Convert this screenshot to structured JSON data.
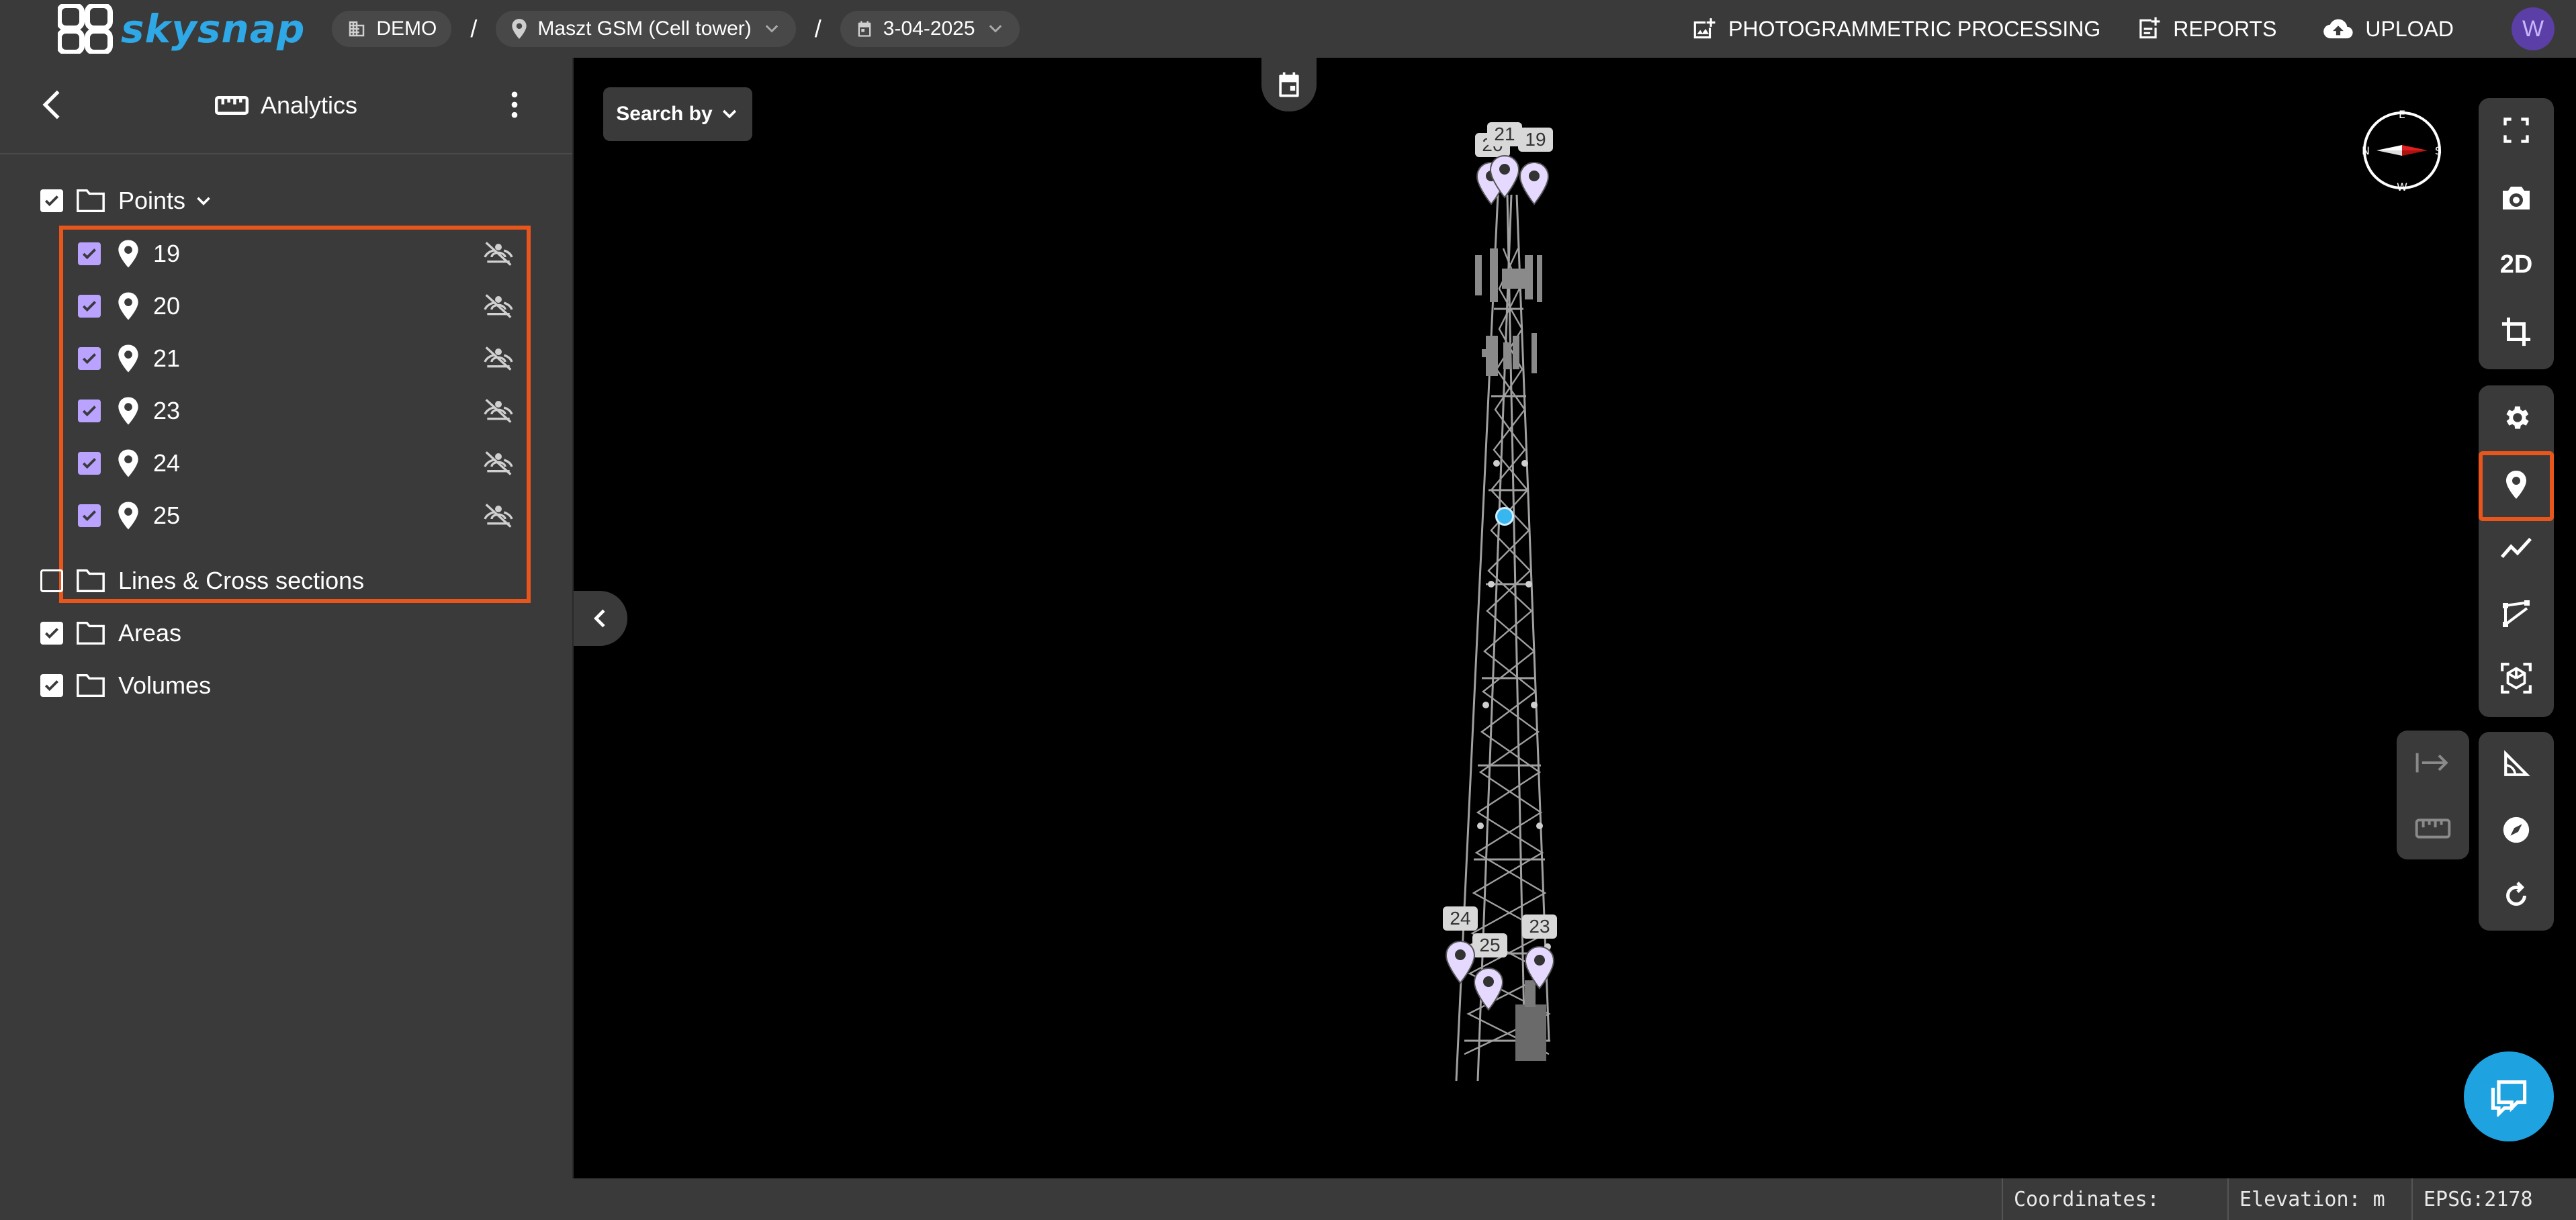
{
  "app": {
    "brand": "skysnap"
  },
  "topbar": {
    "breadcrumbs": [
      {
        "label": "DEMO",
        "icon": "building-icon"
      },
      {
        "label": "Maszt GSM (Cell tower)",
        "icon": "location-pin-icon"
      },
      {
        "label": "3-04-2025",
        "icon": "calendar-icon"
      }
    ],
    "separator": "/",
    "actions": {
      "processing": "PHOTOGRAMMETRIC PROCESSING",
      "reports": "REPORTS",
      "upload": "UPLOAD"
    },
    "avatar_initial": "W"
  },
  "panel": {
    "title": "Analytics",
    "folders": {
      "points": {
        "label": "Points",
        "checked": true
      },
      "lines": {
        "label": "Lines & Cross sections",
        "checked": false
      },
      "areas": {
        "label": "Areas",
        "checked": true
      },
      "volumes": {
        "label": "Volumes",
        "checked": true
      }
    },
    "points": [
      {
        "label": "19",
        "checked": true
      },
      {
        "label": "20",
        "checked": true
      },
      {
        "label": "21",
        "checked": true
      },
      {
        "label": "23",
        "checked": true
      },
      {
        "label": "24",
        "checked": true
      },
      {
        "label": "25",
        "checked": true
      }
    ]
  },
  "map": {
    "search_by": "Search by",
    "toolbar": {
      "mode_2d": "2D"
    },
    "point_tags": [
      "19",
      "20",
      "21",
      "23",
      "24",
      "25"
    ]
  },
  "status": {
    "coordinates": "Coordinates:",
    "elevation": "Elevation: m",
    "epsg": "EPSG:2178"
  },
  "colors": {
    "accent": "#e8561b",
    "checkbox": "#b9a3ff",
    "brand": "#2ea8e6",
    "pin": "#e6d9ff"
  }
}
